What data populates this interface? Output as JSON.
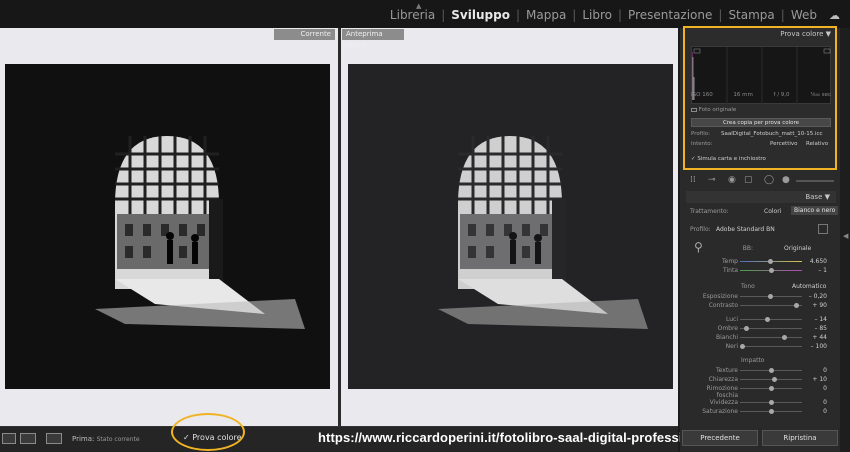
{
  "modules": [
    "Libreria",
    "Sviluppo",
    "Mappa",
    "Libro",
    "Presentazione",
    "Stampa",
    "Web"
  ],
  "active_module": "Sviluppo",
  "view": {
    "label_left": "Corrente",
    "label_right": "Anteprima prova"
  },
  "toolbar": {
    "prima_label": "Prima:",
    "prima_value": "Stato corrente",
    "proof_label": "Prova colore",
    "proof_check": "✓"
  },
  "watermark_url": "https://www.riccardoperini.it/fotolibro-saal-digital-professional-line/",
  "softproof": {
    "title": "Prova colore",
    "iso": "ISO 160",
    "focal": "16 mm",
    "aperture": "f / 9,0",
    "shutter": "¹⁄₆₄₀ sec",
    "original_label": "Foto originale",
    "create_button": "Crea copia per prova colore",
    "profile_label": "Profilo:",
    "profile_value": "SaalDigital_Fotobuch_matt_10-15.icc",
    "intent_label": "Intento:",
    "intent_options": [
      "Percettivo",
      "Relativo"
    ],
    "simulate_label": "Simula carta e inchiostro"
  },
  "basic": {
    "title": "Base",
    "treatment_label": "Trattamento:",
    "treatment_options": [
      "Colori",
      "Bianco e nero"
    ],
    "profile_label": "Profilo:",
    "profile_value": "Adobe Standard BN",
    "wb_label": "BB:",
    "wb_value": "Originale",
    "temp_label": "Temp",
    "temp_value": "4.650",
    "tint_label": "Tinta",
    "tint_value": "– 1",
    "tone_label": "Tono",
    "auto_label": "Automatico",
    "exposure_label": "Esposizione",
    "exposure_value": "– 0,20",
    "contrast_label": "Contrasto",
    "contrast_value": "+ 90",
    "highlights_label": "Luci",
    "highlights_value": "– 14",
    "shadows_label": "Ombre",
    "shadows_value": "– 85",
    "whites_label": "Bianchi",
    "whites_value": "+ 44",
    "blacks_label": "Neri",
    "blacks_value": "– 100",
    "presence_label": "Impatto",
    "texture_label": "Texture",
    "texture_value": "0",
    "clarity_label": "Chiarezza",
    "clarity_value": "+ 10",
    "dehaze_label": "Rimozione foschia",
    "dehaze_value": "0",
    "vibrance_label": "Vividezza",
    "vibrance_value": "0",
    "saturation_label": "Saturazione",
    "saturation_value": "0"
  },
  "panel_buttons": {
    "previous": "Precedente",
    "reset": "Ripristina"
  },
  "colors": {
    "highlight_ring": "#f0b323",
    "panel_bg": "#2a2a2a",
    "view_bg": "#e9e9ee"
  }
}
